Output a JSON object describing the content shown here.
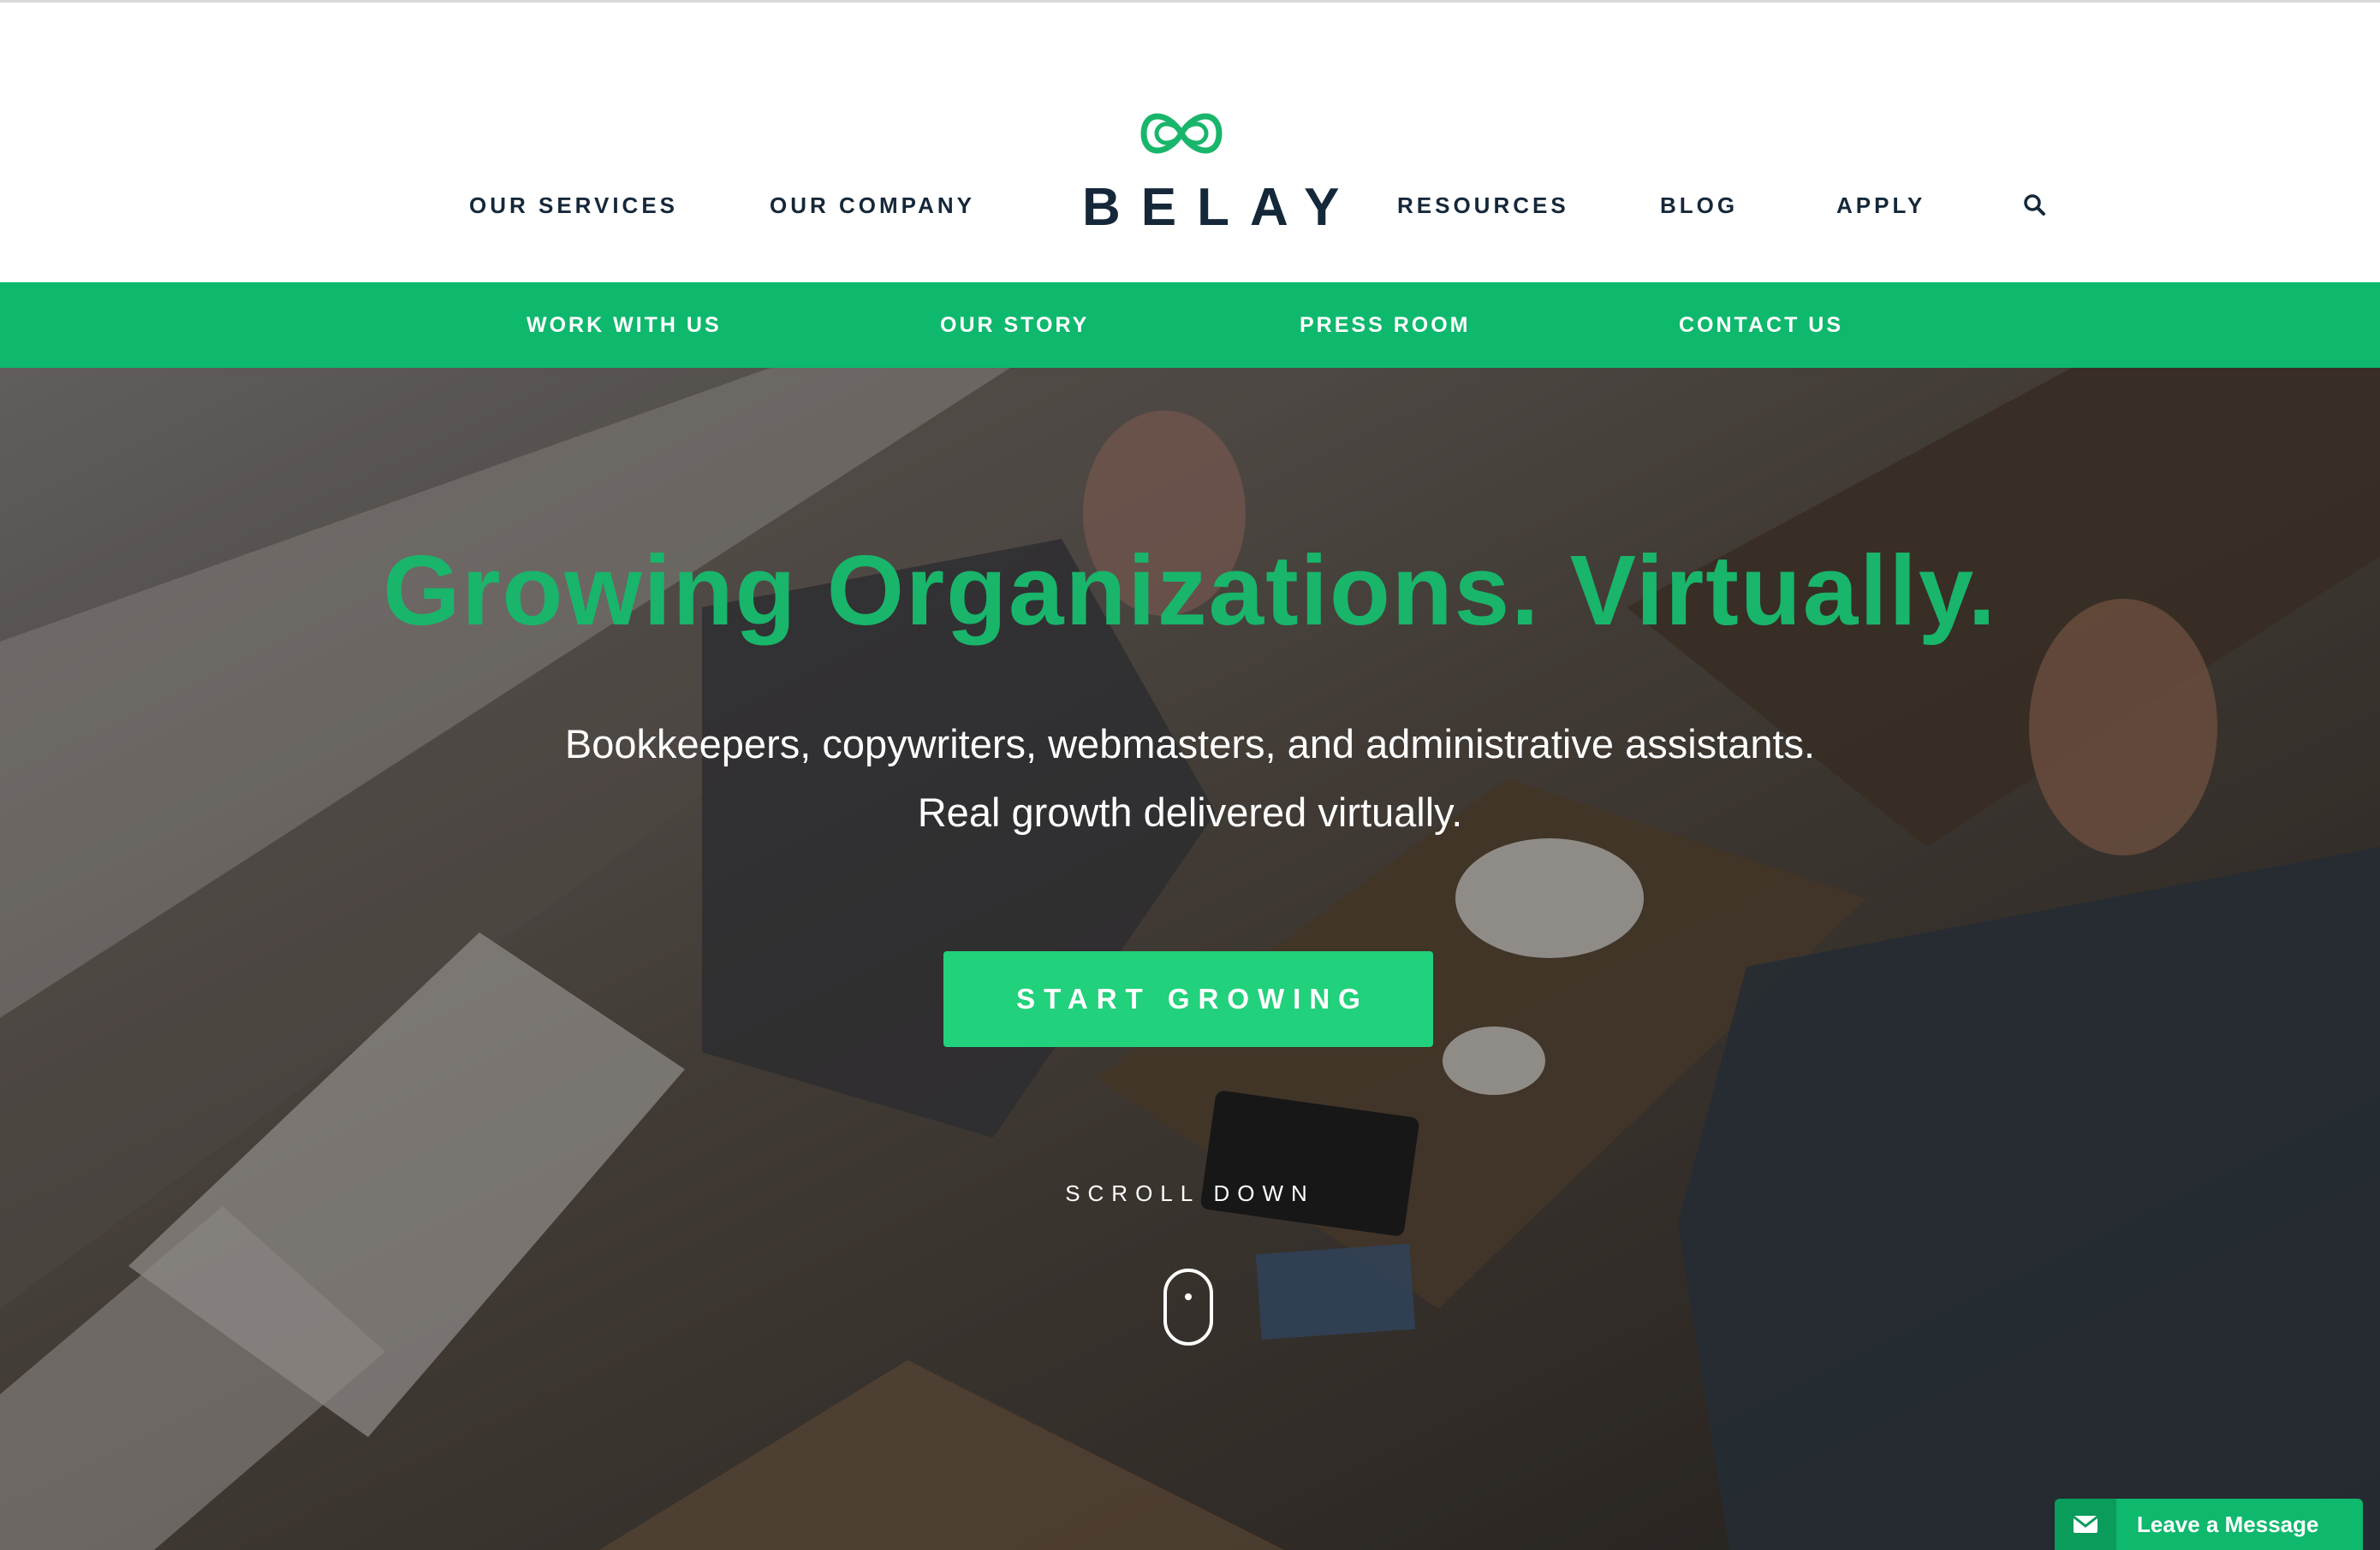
{
  "header": {
    "logo_text": "BELAY",
    "nav_left": [
      "OUR SERVICES",
      "OUR COMPANY"
    ],
    "nav_right": [
      "RESOURCES",
      "BLOG",
      "APPLY"
    ],
    "search_icon": "search-icon"
  },
  "subnav": {
    "items": [
      "WORK WITH US",
      "OUR STORY",
      "PRESS ROOM",
      "CONTACT US"
    ]
  },
  "hero": {
    "title": "Growing Organizations. Virtually.",
    "subtitle_line1": "Bookkeepers, copywriters, webmasters, and administrative assistants.",
    "subtitle_line2": "Real growth delivered virtually.",
    "cta_label": "START GROWING",
    "scroll_label": "SCROLL DOWN",
    "scroll_icon": "mouse-icon"
  },
  "chat": {
    "label": "Leave a Message",
    "icon": "envelope-icon"
  },
  "colors": {
    "brand_green": "#0eb86d",
    "cta_green": "#22d17b",
    "title_green": "#19b56b",
    "navy": "#15283a"
  }
}
